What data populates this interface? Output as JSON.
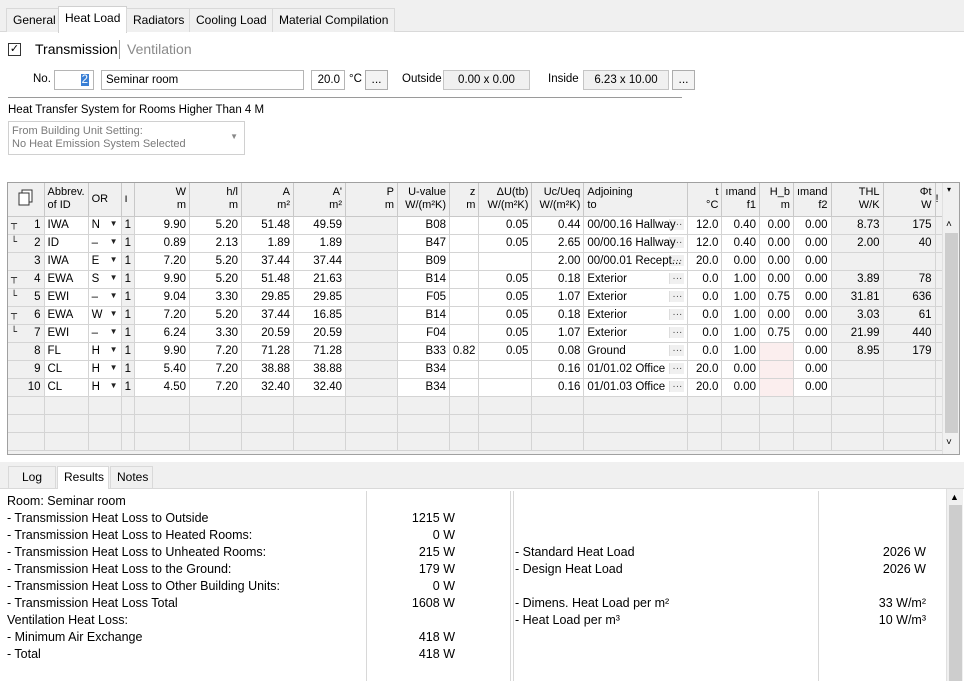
{
  "tabs": [
    "General",
    "Heat Load",
    "Radiators",
    "Cooling Load",
    "Material Compilation"
  ],
  "active_tab": "Heat Load",
  "mode": {
    "transmission_label": "Transmission",
    "ventilation_label": "Ventilation",
    "checkbox_checked": "✓"
  },
  "room": {
    "no_label": "No.",
    "no_value": "2",
    "name_value": "Seminar room",
    "temp_value": "20.0",
    "temp_unit": "°C",
    "ellipsis": "...",
    "outside_label": "Outside",
    "outside_value": "0.00 x 0.00",
    "inside_label": "Inside",
    "inside_value": "6.23 x 10.00"
  },
  "heat_transfer": {
    "heading": "Heat Transfer System for Rooms Higher Than 4 M",
    "line1": "From Building Unit Setting:",
    "line2": "No Heat Emission System Selected"
  },
  "grid": {
    "headers": [
      {
        "t": "",
        "b": ""
      },
      {
        "t": "Abbrev.",
        "b": "of ID"
      },
      {
        "t": "OR",
        "b": ""
      },
      {
        "t": "ו",
        "b": ""
      },
      {
        "t": "W",
        "b": "m"
      },
      {
        "t": "h/l",
        "b": "m"
      },
      {
        "t": "A",
        "b": "m²"
      },
      {
        "t": "A'",
        "b": "m²"
      },
      {
        "t": "P",
        "b": "m"
      },
      {
        "t": "U-value",
        "b": "W/(m²K)"
      },
      {
        "t": "z",
        "b": "m"
      },
      {
        "t": "ΔU(tb)",
        "b": "W/(m²K)"
      },
      {
        "t": "Uc/Ueq",
        "b": "W/(m²K)"
      },
      {
        "t": "Adjoining",
        "b": "to"
      },
      {
        "t": "t",
        "b": "°C"
      },
      {
        "t": "ımand",
        "b": "f1"
      },
      {
        "t": "H_b",
        "b": "m"
      },
      {
        "t": "ımand",
        "b": "f2"
      },
      {
        "t": "THL",
        "b": "W/K"
      },
      {
        "t": "Φt",
        "b": "W"
      },
      {
        "t": "!",
        "b": ""
      }
    ],
    "rows": [
      {
        "tree": "┬",
        "no": "1",
        "abbr": "IWA",
        "or": "N",
        "n": "1",
        "w": "9.90",
        "h": "5.20",
        "a": "51.48",
        "a2": "49.59",
        "p": "",
        "u": "B08",
        "z": "",
        "du": "0.05",
        "uc": "0.44",
        "adj": "00/00.16 Hallway",
        "t": "12.0",
        "f1": "0.40",
        "hb": "0.00",
        "f2": "0.00",
        "thl": "8.73",
        "phi": "175"
      },
      {
        "tree": "└",
        "no": "2",
        "abbr": "ID",
        "or": "–",
        "n": "1",
        "w": "0.89",
        "h": "2.13",
        "a": "1.89",
        "a2": "1.89",
        "p": "",
        "u": "B47",
        "z": "",
        "du": "0.05",
        "uc": "2.65",
        "adj": "00/00.16 Hallway",
        "t": "12.0",
        "f1": "0.40",
        "hb": "0.00",
        "f2": "0.00",
        "thl": "2.00",
        "phi": "40"
      },
      {
        "tree": "",
        "no": "3",
        "abbr": "IWA",
        "or": "E",
        "n": "1",
        "w": "7.20",
        "h": "5.20",
        "a": "37.44",
        "a2": "37.44",
        "p": "",
        "u": "B09",
        "z": "",
        "du": "",
        "uc": "2.00",
        "adj": "00/00.01 Recept...",
        "t": "20.0",
        "f1": "0.00",
        "hb": "0.00",
        "f2": "0.00",
        "thl": "",
        "phi": ""
      },
      {
        "tree": "┬",
        "no": "4",
        "abbr": "EWA",
        "or": "S",
        "n": "1",
        "w": "9.90",
        "h": "5.20",
        "a": "51.48",
        "a2": "21.63",
        "p": "",
        "u": "B14",
        "z": "",
        "du": "0.05",
        "uc": "0.18",
        "adj": "Exterior",
        "t": "0.0",
        "f1": "1.00",
        "hb": "0.00",
        "f2": "0.00",
        "thl": "3.89",
        "phi": "78"
      },
      {
        "tree": "└",
        "no": "5",
        "abbr": "EWI",
        "or": "–",
        "n": "1",
        "w": "9.04",
        "h": "3.30",
        "a": "29.85",
        "a2": "29.85",
        "p": "",
        "u": "F05",
        "z": "",
        "du": "0.05",
        "uc": "1.07",
        "adj": "Exterior",
        "t": "0.0",
        "f1": "1.00",
        "hb": "0.75",
        "f2": "0.00",
        "thl": "31.81",
        "phi": "636"
      },
      {
        "tree": "┬",
        "no": "6",
        "abbr": "EWA",
        "or": "W",
        "n": "1",
        "w": "7.20",
        "h": "5.20",
        "a": "37.44",
        "a2": "16.85",
        "p": "",
        "u": "B14",
        "z": "",
        "du": "0.05",
        "uc": "0.18",
        "adj": "Exterior",
        "t": "0.0",
        "f1": "1.00",
        "hb": "0.00",
        "f2": "0.00",
        "thl": "3.03",
        "phi": "61"
      },
      {
        "tree": "└",
        "no": "7",
        "abbr": "EWI",
        "or": "–",
        "n": "1",
        "w": "6.24",
        "h": "3.30",
        "a": "20.59",
        "a2": "20.59",
        "p": "",
        "u": "F04",
        "z": "",
        "du": "0.05",
        "uc": "1.07",
        "adj": "Exterior",
        "t": "0.0",
        "f1": "1.00",
        "hb": "0.75",
        "f2": "0.00",
        "thl": "21.99",
        "phi": "440"
      },
      {
        "tree": "",
        "no": "8",
        "abbr": "FL",
        "or": "H",
        "n": "1",
        "w": "9.90",
        "h": "7.20",
        "a": "71.28",
        "a2": "71.28",
        "p": "",
        "u": "B33",
        "z": "0.82",
        "du": "0.05",
        "uc": "0.08",
        "adj": "Ground",
        "t": "0.0",
        "f1": "1.00",
        "hb": "",
        "f2": "0.00",
        "thl": "8.95",
        "phi": "179"
      },
      {
        "tree": "",
        "no": "9",
        "abbr": "CL",
        "or": "H",
        "n": "1",
        "w": "5.40",
        "h": "7.20",
        "a": "38.88",
        "a2": "38.88",
        "p": "",
        "u": "B34",
        "z": "",
        "du": "",
        "uc": "0.16",
        "adj": "01/01.02 Office",
        "t": "20.0",
        "f1": "0.00",
        "hb": "",
        "f2": "0.00",
        "thl": "",
        "phi": ""
      },
      {
        "tree": "",
        "no": "10",
        "abbr": "CL",
        "or": "H",
        "n": "1",
        "w": "4.50",
        "h": "7.20",
        "a": "32.40",
        "a2": "32.40",
        "p": "",
        "u": "B34",
        "z": "",
        "du": "",
        "uc": "0.16",
        "adj": "01/01.03 Office",
        "t": "20.0",
        "f1": "0.00",
        "hb": "",
        "f2": "0.00",
        "thl": "",
        "phi": ""
      }
    ]
  },
  "bottom_tabs": [
    "Log",
    "Results",
    "Notes"
  ],
  "results": {
    "left": [
      {
        "label": "Room: Seminar room",
        "value": ""
      },
      {
        "label": "- Transmission Heat Loss to Outside",
        "value": "1215 W"
      },
      {
        "label": "- Transmission Heat Loss to Heated Rooms:",
        "value": "0 W"
      },
      {
        "label": "- Transmission Heat Loss to Unheated Rooms:",
        "value": "215 W"
      },
      {
        "label": "- Transmission Heat Loss to the Ground:",
        "value": "179 W"
      },
      {
        "label": "- Transmission Heat Loss to Other Building Units:",
        "value": "0 W"
      },
      {
        "label": "- Transmission Heat Loss Total",
        "value": "1608 W"
      },
      {
        "label": "Ventilation Heat Loss:",
        "value": ""
      },
      {
        "label": "- Minimum Air Exchange",
        "value": "418 W"
      },
      {
        "label": "- Total",
        "value": "418 W"
      }
    ],
    "right": [
      {
        "row": 3,
        "label": "- Standard Heat Load",
        "value": "2026 W"
      },
      {
        "row": 4,
        "label": "- Design Heat Load",
        "value": "2026 W"
      },
      {
        "row": 6,
        "label": "- Dimens. Heat Load per m²",
        "value": "33 W/m²"
      },
      {
        "row": 7,
        "label": "- Heat Load per m³",
        "value": "10 W/m³"
      }
    ]
  }
}
